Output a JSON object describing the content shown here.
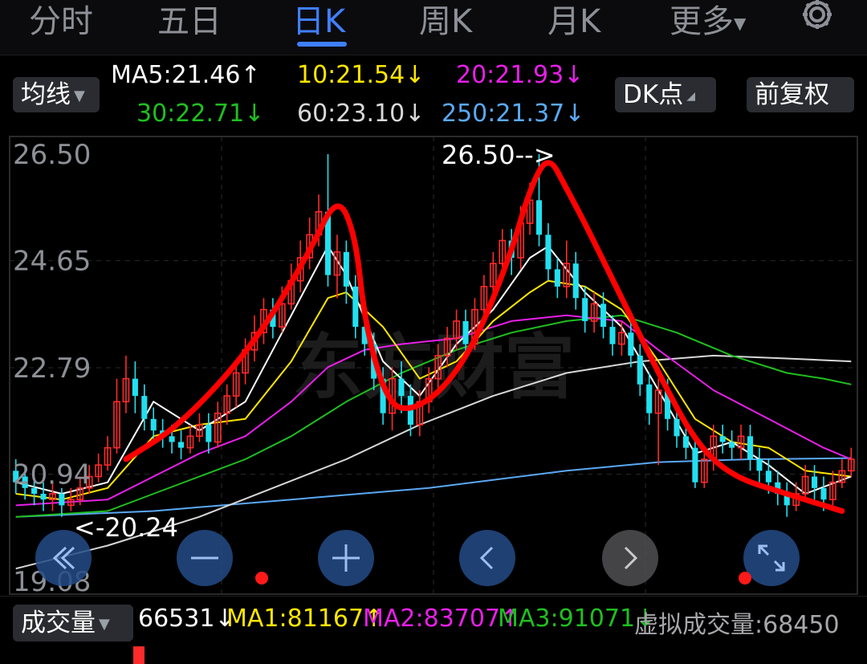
{
  "tabs": [
    {
      "label": "分时",
      "active": false
    },
    {
      "label": "五日",
      "active": false
    },
    {
      "label": "日K",
      "active": true
    },
    {
      "label": "周K",
      "active": false
    },
    {
      "label": "月K",
      "active": false
    },
    {
      "label": "更多",
      "active": false
    }
  ],
  "indicator_select": "均线",
  "dk_button": "DK点",
  "adjust_button": "前复权",
  "ma_legend": [
    {
      "text": "MA5:21.46↑",
      "color": "#ffffff"
    },
    {
      "text": "10:21.54↓",
      "color": "#ffe600"
    },
    {
      "text": "20:21.93↓",
      "color": "#e81fe8"
    },
    {
      "text": "30:22.71↓",
      "color": "#1fbf1f"
    },
    {
      "text": "60:23.10↓",
      "color": "#d8d8d8"
    },
    {
      "text": "250:21.37↓",
      "color": "#5aa9f5"
    }
  ],
  "watermark": "东方财富",
  "volume": {
    "select": "成交量",
    "current": "66531↓",
    "ma1": "MA1:81167↑",
    "ma2": "MA2:83707↑",
    "ma3": "MA3:91071↓",
    "virtual": "虚拟成交量:68450"
  },
  "colors": {
    "up": "#ff2a2a",
    "down": "#22e0f0",
    "ma5": "#ffffff",
    "ma10": "#ffe600",
    "ma20": "#e81fe8",
    "ma30": "#1fbf1f",
    "ma60": "#d8d8d8",
    "ma250": "#5aa9f5",
    "accent": "#3f80ff",
    "annotation": "#ff0000"
  },
  "chart_data": {
    "type": "candlestick",
    "y_ticks": [
      "26.50",
      "24.65",
      "22.79",
      "20.94",
      "19.08"
    ],
    "y_tick_values": [
      26.5,
      24.65,
      22.79,
      20.94,
      19.08
    ],
    "ylim": [
      19.08,
      26.5
    ],
    "grid": true,
    "high_label": "26.50-->",
    "low_label": "<-20.24",
    "high_value": 26.5,
    "low_value": 20.24,
    "candles": [
      [
        21.0,
        20.8,
        21.2,
        20.6
      ],
      [
        20.9,
        20.7,
        21.1,
        20.5
      ],
      [
        20.7,
        20.6,
        20.9,
        20.4
      ],
      [
        20.6,
        20.5,
        20.8,
        20.3
      ],
      [
        20.5,
        20.6,
        20.8,
        20.3
      ],
      [
        20.6,
        20.4,
        20.7,
        20.2
      ],
      [
        20.4,
        20.5,
        20.7,
        20.3
      ],
      [
        20.5,
        20.7,
        20.9,
        20.4
      ],
      [
        20.7,
        20.9,
        21.1,
        20.6
      ],
      [
        20.9,
        21.1,
        21.3,
        20.8
      ],
      [
        21.1,
        21.4,
        21.6,
        21.0
      ],
      [
        21.4,
        22.2,
        22.6,
        21.3
      ],
      [
        22.2,
        22.6,
        23.0,
        22.0
      ],
      [
        22.6,
        22.3,
        22.9,
        22.0
      ],
      [
        22.3,
        21.9,
        22.5,
        21.7
      ],
      [
        21.9,
        21.7,
        22.1,
        21.5
      ],
      [
        21.7,
        21.6,
        21.9,
        21.4
      ],
      [
        21.6,
        21.5,
        21.8,
        21.3
      ],
      [
        21.5,
        21.4,
        21.7,
        21.2
      ],
      [
        21.4,
        21.6,
        21.8,
        21.3
      ],
      [
        21.6,
        21.8,
        22.0,
        21.5
      ],
      [
        21.8,
        21.5,
        22.0,
        21.3
      ],
      [
        21.5,
        22.0,
        22.2,
        21.4
      ],
      [
        22.0,
        22.3,
        22.5,
        21.8
      ],
      [
        22.3,
        22.7,
        22.9,
        22.1
      ],
      [
        22.7,
        23.1,
        23.3,
        22.5
      ],
      [
        23.1,
        23.4,
        23.7,
        22.9
      ],
      [
        23.4,
        23.8,
        24.0,
        23.2
      ],
      [
        23.8,
        23.5,
        24.0,
        23.3
      ],
      [
        23.5,
        23.9,
        24.2,
        23.4
      ],
      [
        23.9,
        24.3,
        24.6,
        23.8
      ],
      [
        24.3,
        24.7,
        25.0,
        24.1
      ],
      [
        24.7,
        25.1,
        25.4,
        24.5
      ],
      [
        25.1,
        25.5,
        25.8,
        24.9
      ],
      [
        25.5,
        24.4,
        26.5,
        24.2
      ],
      [
        24.4,
        24.8,
        25.1,
        24.0
      ],
      [
        24.8,
        24.2,
        25.0,
        23.9
      ],
      [
        24.2,
        23.5,
        24.4,
        23.3
      ],
      [
        23.5,
        23.2,
        23.7,
        23.0
      ],
      [
        23.2,
        22.6,
        23.4,
        22.4
      ],
      [
        22.6,
        22.0,
        22.8,
        21.8
      ],
      [
        22.0,
        22.6,
        22.8,
        21.7
      ],
      [
        22.6,
        22.3,
        22.9,
        22.0
      ],
      [
        22.3,
        21.8,
        22.5,
        21.6
      ],
      [
        21.8,
        22.2,
        22.4,
        21.6
      ],
      [
        22.2,
        22.6,
        22.8,
        22.0
      ],
      [
        22.6,
        23.0,
        23.2,
        22.4
      ],
      [
        23.0,
        23.3,
        23.5,
        22.8
      ],
      [
        23.3,
        23.6,
        23.8,
        23.1
      ],
      [
        23.6,
        23.2,
        23.8,
        23.0
      ],
      [
        23.2,
        23.8,
        24.0,
        23.1
      ],
      [
        23.8,
        24.2,
        24.4,
        23.6
      ],
      [
        24.2,
        24.6,
        24.8,
        24.0
      ],
      [
        24.6,
        25.0,
        25.2,
        24.4
      ],
      [
        25.0,
        24.7,
        25.2,
        24.4
      ],
      [
        24.7,
        25.3,
        25.6,
        24.5
      ],
      [
        25.3,
        25.7,
        26.0,
        25.1
      ],
      [
        25.7,
        25.1,
        26.5,
        24.9
      ],
      [
        25.1,
        24.5,
        25.3,
        24.3
      ],
      [
        24.5,
        24.2,
        24.7,
        24.0
      ],
      [
        24.2,
        24.6,
        25.0,
        24.0
      ],
      [
        24.6,
        24.0,
        24.8,
        23.8
      ],
      [
        24.0,
        23.6,
        24.2,
        23.4
      ],
      [
        23.6,
        23.9,
        24.1,
        23.4
      ],
      [
        23.9,
        23.5,
        24.1,
        23.3
      ],
      [
        23.5,
        23.2,
        23.7,
        23.0
      ],
      [
        23.2,
        23.4,
        23.6,
        23.0
      ],
      [
        23.4,
        23.0,
        23.6,
        22.8
      ],
      [
        23.0,
        22.5,
        23.2,
        22.3
      ],
      [
        22.5,
        22.0,
        22.7,
        21.8
      ],
      [
        22.0,
        22.4,
        22.6,
        21.1
      ],
      [
        22.4,
        21.9,
        22.6,
        21.7
      ],
      [
        21.9,
        21.6,
        22.1,
        21.4
      ],
      [
        21.6,
        21.4,
        21.8,
        21.2
      ],
      [
        21.4,
        20.8,
        21.6,
        20.7
      ],
      [
        20.8,
        21.2,
        21.4,
        20.7
      ],
      [
        21.2,
        21.6,
        21.8,
        21.0
      ],
      [
        21.6,
        21.5,
        21.8,
        21.3
      ],
      [
        21.5,
        21.4,
        21.7,
        21.2
      ],
      [
        21.4,
        21.6,
        21.8,
        21.2
      ],
      [
        21.6,
        21.2,
        21.8,
        21.0
      ],
      [
        21.2,
        21.0,
        21.4,
        20.8
      ],
      [
        21.0,
        20.8,
        21.2,
        20.6
      ],
      [
        20.8,
        20.6,
        21.0,
        20.4
      ],
      [
        20.6,
        20.4,
        20.8,
        20.2
      ],
      [
        20.4,
        20.6,
        20.8,
        20.3
      ],
      [
        20.6,
        20.9,
        21.1,
        20.5
      ],
      [
        20.9,
        20.7,
        21.1,
        20.5
      ],
      [
        20.7,
        20.5,
        20.9,
        20.3
      ],
      [
        20.5,
        20.8,
        21.0,
        20.4
      ],
      [
        20.8,
        21.0,
        21.2,
        20.7
      ],
      [
        21.0,
        21.2,
        21.4,
        20.9
      ]
    ],
    "ma_lines": {
      "ma5": [
        [
          0,
          20.8
        ],
        [
          5,
          20.6
        ],
        [
          10,
          20.8
        ],
        [
          15,
          22.2
        ],
        [
          20,
          21.7
        ],
        [
          25,
          22.2
        ],
        [
          30,
          23.7
        ],
        [
          34,
          24.9
        ],
        [
          36,
          24.4
        ],
        [
          40,
          22.9
        ],
        [
          44,
          22.3
        ],
        [
          48,
          23.2
        ],
        [
          52,
          23.8
        ],
        [
          56,
          24.7
        ],
        [
          58,
          24.9
        ],
        [
          62,
          24.1
        ],
        [
          66,
          23.5
        ],
        [
          70,
          22.4
        ],
        [
          74,
          21.3
        ],
        [
          78,
          21.5
        ],
        [
          82,
          21.1
        ],
        [
          86,
          20.6
        ],
        [
          91,
          20.9
        ]
      ],
      "ma10": [
        [
          0,
          20.6
        ],
        [
          5,
          20.5
        ],
        [
          10,
          20.7
        ],
        [
          15,
          21.6
        ],
        [
          20,
          21.8
        ],
        [
          25,
          21.9
        ],
        [
          30,
          22.9
        ],
        [
          34,
          24.0
        ],
        [
          36,
          24.1
        ],
        [
          40,
          23.5
        ],
        [
          44,
          22.6
        ],
        [
          48,
          22.9
        ],
        [
          52,
          23.6
        ],
        [
          56,
          24.1
        ],
        [
          58,
          24.3
        ],
        [
          62,
          24.2
        ],
        [
          66,
          23.8
        ],
        [
          70,
          22.9
        ],
        [
          74,
          21.9
        ],
        [
          78,
          21.5
        ],
        [
          82,
          21.4
        ],
        [
          86,
          21.0
        ],
        [
          91,
          20.9
        ]
      ],
      "ma20": [
        [
          0,
          20.4
        ],
        [
          10,
          20.5
        ],
        [
          15,
          20.9
        ],
        [
          20,
          21.3
        ],
        [
          25,
          21.6
        ],
        [
          30,
          22.2
        ],
        [
          34,
          22.8
        ],
        [
          38,
          23.1
        ],
        [
          42,
          23.2
        ],
        [
          48,
          23.3
        ],
        [
          54,
          23.6
        ],
        [
          60,
          23.7
        ],
        [
          66,
          23.6
        ],
        [
          70,
          23.1
        ],
        [
          76,
          22.4
        ],
        [
          82,
          21.9
        ],
        [
          88,
          21.4
        ],
        [
          91,
          21.2
        ]
      ],
      "ma30": [
        [
          0,
          20.2
        ],
        [
          10,
          20.3
        ],
        [
          15,
          20.6
        ],
        [
          20,
          20.9
        ],
        [
          25,
          21.2
        ],
        [
          30,
          21.6
        ],
        [
          36,
          22.2
        ],
        [
          42,
          22.7
        ],
        [
          48,
          23.1
        ],
        [
          54,
          23.4
        ],
        [
          60,
          23.6
        ],
        [
          66,
          23.7
        ],
        [
          72,
          23.4
        ],
        [
          78,
          23.0
        ],
        [
          84,
          22.7
        ],
        [
          88,
          22.6
        ],
        [
          91,
          22.5
        ]
      ],
      "ma60": [
        [
          0,
          19.3
        ],
        [
          10,
          19.7
        ],
        [
          20,
          20.2
        ],
        [
          28,
          20.7
        ],
        [
          36,
          21.2
        ],
        [
          44,
          21.8
        ],
        [
          52,
          22.3
        ],
        [
          60,
          22.7
        ],
        [
          68,
          22.9
        ],
        [
          76,
          23.0
        ],
        [
          84,
          22.95
        ],
        [
          91,
          22.9
        ]
      ],
      "ma250": [
        [
          0,
          20.2
        ],
        [
          15,
          20.3
        ],
        [
          30,
          20.5
        ],
        [
          45,
          20.7
        ],
        [
          60,
          21.0
        ],
        [
          70,
          21.15
        ],
        [
          80,
          21.2
        ],
        [
          91,
          21.22
        ]
      ]
    },
    "annotation_path": [
      [
        12,
        21.2
      ],
      [
        18,
        21.8
      ],
      [
        26,
        23.2
      ],
      [
        32,
        24.8
      ],
      [
        35,
        25.8
      ],
      [
        37,
        25.1
      ],
      [
        38,
        23.6
      ],
      [
        40,
        22.4
      ],
      [
        42,
        22.0
      ],
      [
        46,
        22.3
      ],
      [
        50,
        23.2
      ],
      [
        54,
        24.8
      ],
      [
        56,
        25.9
      ],
      [
        58,
        26.5
      ],
      [
        60,
        25.9
      ],
      [
        62,
        25.3
      ],
      [
        66,
        24.0
      ],
      [
        70,
        22.7
      ],
      [
        74,
        21.5
      ],
      [
        78,
        20.9
      ],
      [
        84,
        20.6
      ],
      [
        90,
        20.3
      ]
    ]
  }
}
